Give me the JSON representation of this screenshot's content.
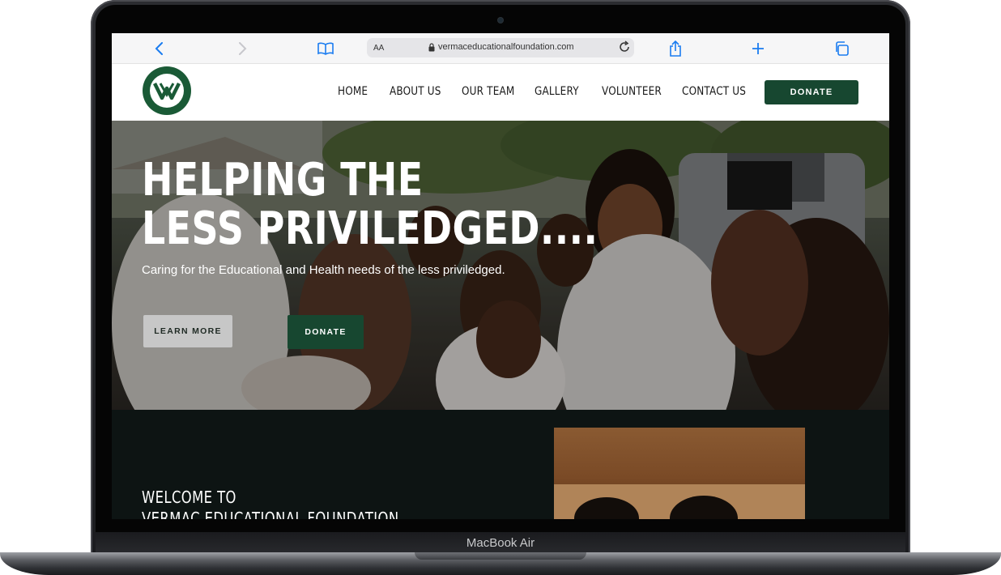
{
  "device": {
    "label": "MacBook Air"
  },
  "browser": {
    "text_size_label": "AA",
    "url": "vermaceducationalfoundation.com",
    "icons": [
      "back-icon",
      "forward-icon",
      "book-icon",
      "lock-icon",
      "reload-icon",
      "share-icon",
      "new-tab-icon",
      "tabs-icon"
    ]
  },
  "site": {
    "logo_alt": "Vermac Educational Foundation logo",
    "nav": [
      {
        "label": "HOME"
      },
      {
        "label": "ABOUT US"
      },
      {
        "label": "OUR TEAM"
      },
      {
        "label": "GALLERY"
      },
      {
        "label": "VOLUNTEER"
      },
      {
        "label": "CONTACT US"
      }
    ],
    "donate_label": "DONATE"
  },
  "hero": {
    "title_line1": "HELPING THE",
    "title_line2": "LESS PRIVILEDGED....",
    "subtitle": "Caring for the Educational and Health needs of the less priviledged.",
    "learn_more_label": "LEARN MORE",
    "donate_label": "DONATE"
  },
  "welcome": {
    "line1": "WELCOME TO",
    "line2": "VERMAC EDUCATIONAL FOUNDATION"
  },
  "colors": {
    "brand_green": "#174730",
    "dark_section": "#0d1413",
    "ios_blue": "#1a7cf0"
  }
}
